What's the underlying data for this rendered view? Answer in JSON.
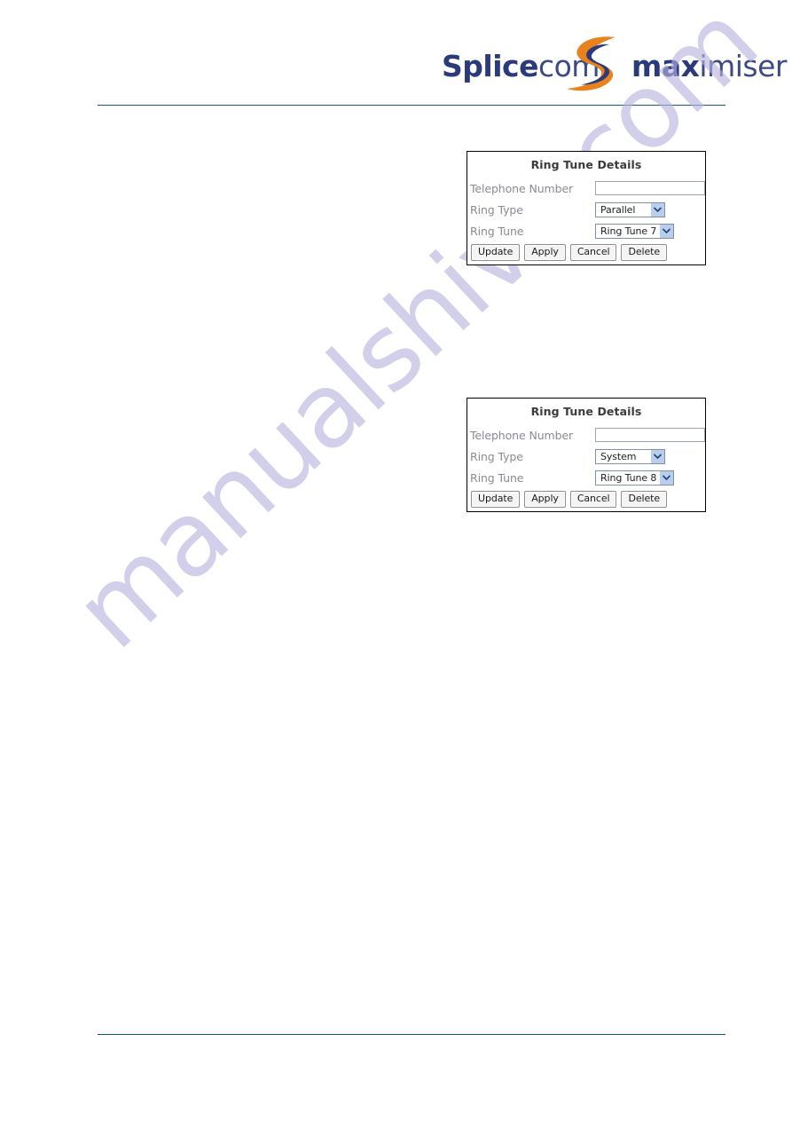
{
  "document": {
    "background_color": "#ffffff",
    "rule_color": "#14577f"
  },
  "watermark": {
    "text": "manualshive.com",
    "color": "#b7b3e0"
  },
  "logo": {
    "part_splice": "Splice",
    "part_com": "com",
    "part_max": "max",
    "part_imiser": "imiser",
    "swoosh_orange": "#e8821e",
    "swoosh_navy": "#2b3a7a",
    "text_color": "#2b3a7a"
  },
  "panels": [
    {
      "title": "Ring Tune Details",
      "fields": {
        "telephone_number_label": "Telephone Number",
        "telephone_number_value": "",
        "telephone_number_placeholder": "",
        "ring_type_label": "Ring Type",
        "ring_type_value": "Parallel",
        "ring_tune_label": "Ring Tune",
        "ring_tune_value": "Ring Tune 7"
      },
      "buttons": {
        "update": "Update",
        "apply": "Apply",
        "cancel": "Cancel",
        "delete": "Delete"
      }
    },
    {
      "title": "Ring Tune Details",
      "fields": {
        "telephone_number_label": "Telephone Number",
        "telephone_number_value": "",
        "telephone_number_placeholder": "",
        "ring_type_label": "Ring Type",
        "ring_type_value": "System",
        "ring_tune_label": "Ring Tune",
        "ring_tune_value": "Ring Tune 8"
      },
      "buttons": {
        "update": "Update",
        "apply": "Apply",
        "cancel": "Cancel",
        "delete": "Delete"
      }
    }
  ]
}
